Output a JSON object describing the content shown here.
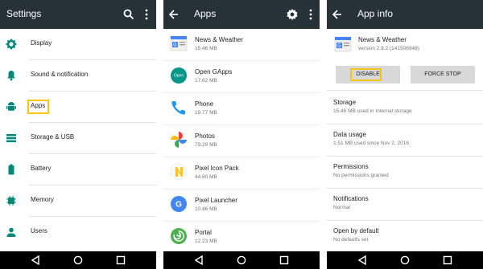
{
  "settings": {
    "title": "Settings",
    "items": [
      {
        "label": "Display",
        "icon": "brightness-icon"
      },
      {
        "label": "Sound & notification",
        "icon": "bell-icon"
      },
      {
        "label": "Apps",
        "icon": "android-icon"
      },
      {
        "label": "Storage & USB",
        "icon": "storage-icon"
      },
      {
        "label": "Battery",
        "icon": "battery-icon"
      },
      {
        "label": "Memory",
        "icon": "memory-icon"
      },
      {
        "label": "Users",
        "icon": "person-icon"
      }
    ]
  },
  "apps": {
    "title": "Apps",
    "items": [
      {
        "name": "News & Weather",
        "size": "15.46 MB",
        "icon": "news-weather-icon"
      },
      {
        "name": "Open GApps",
        "size": "17.62 MB",
        "icon": "open-gapps-icon"
      },
      {
        "name": "Phone",
        "size": "19.77 MB",
        "icon": "phone-icon"
      },
      {
        "name": "Photos",
        "size": "79.29 MB",
        "icon": "photos-icon"
      },
      {
        "name": "Pixel Icon Pack",
        "size": "44.60 MB",
        "icon": "pixel-icon-pack-icon"
      },
      {
        "name": "Pixel Launcher",
        "size": "10.46 MB",
        "icon": "pixel-launcher-icon"
      },
      {
        "name": "Portal",
        "size": "12.23 MB",
        "icon": "portal-icon"
      }
    ]
  },
  "app_info": {
    "title": "App info",
    "app_name": "News & Weather",
    "version": "version 2.9.2 (141506948)",
    "disable_label": "DISABLE",
    "force_stop_label": "FORCE STOP",
    "rows": [
      {
        "title": "Storage",
        "sub": "15.46 MB used in Internal storage"
      },
      {
        "title": "Data usage",
        "sub": "1.51 MB used since Nov 2, 2016"
      },
      {
        "title": "Permissions",
        "sub": "No permissions granted"
      },
      {
        "title": "Notifications",
        "sub": "Normal"
      },
      {
        "title": "Open by default",
        "sub": "No defaults set"
      }
    ]
  },
  "colors": {
    "appbar": "#263238",
    "highlight": "#f5c518",
    "icon_teal": "#00897b",
    "nav": "#000000"
  }
}
